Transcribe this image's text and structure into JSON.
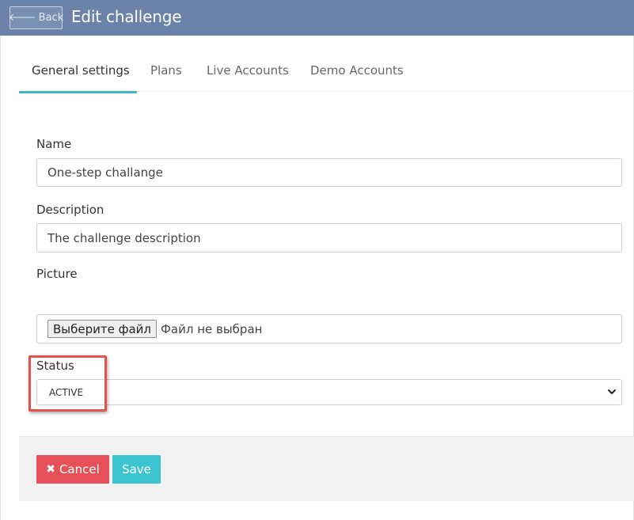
{
  "header": {
    "back_label": "Back",
    "title": "Edit challenge"
  },
  "tabs": [
    {
      "label": "General settings",
      "active": true
    },
    {
      "label": "Plans",
      "active": false
    },
    {
      "label": "Live Accounts",
      "active": false
    },
    {
      "label": "Demo Accounts",
      "active": false
    }
  ],
  "form": {
    "name": {
      "label": "Name",
      "value": "One-step challange"
    },
    "description": {
      "label": "Description",
      "value": "The challenge description"
    },
    "picture": {
      "label": "Picture",
      "button_label": "Выберите файл",
      "status": "Файл не выбран"
    },
    "status": {
      "label": "Status",
      "selected": "ACTIVE"
    }
  },
  "actions": {
    "cancel_label": "Cancel",
    "save_label": "Save"
  },
  "colors": {
    "header_bg": "#6b83a8",
    "tab_accent": "#3fb7c6",
    "cancel_bg": "#e65159",
    "save_bg": "#3cc4d1",
    "highlight_border": "#e0524a"
  },
  "icons": {
    "back": "arrow-left-icon",
    "cancel": "close-icon",
    "select": "chevron-down-icon"
  }
}
